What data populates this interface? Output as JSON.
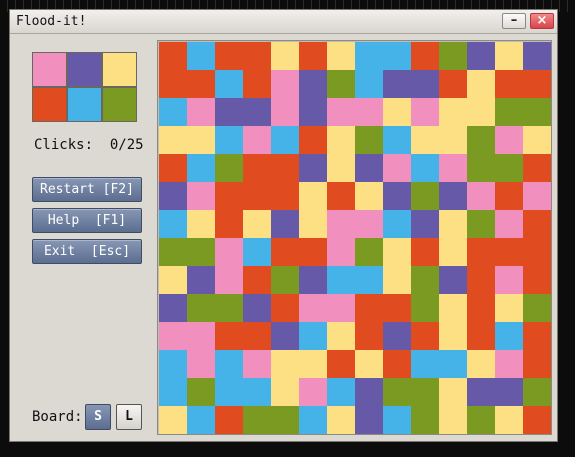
{
  "window": {
    "title": "Flood-it!",
    "minimize_label": "–",
    "close_label": "×"
  },
  "palette": {
    "P": "#f18fbf",
    "V": "#665aa8",
    "Y": "#fde084",
    "R": "#e04b20",
    "B": "#45b2e8",
    "G": "#7a9a21"
  },
  "color_buttons": [
    {
      "key": "P",
      "name": "color-button-pink"
    },
    {
      "key": "V",
      "name": "color-button-purple"
    },
    {
      "key": "Y",
      "name": "color-button-yellow"
    },
    {
      "key": "R",
      "name": "color-button-red"
    },
    {
      "key": "B",
      "name": "color-button-blue"
    },
    {
      "key": "G",
      "name": "color-button-green"
    }
  ],
  "clicks": {
    "label": "Clicks:",
    "value": "0/25"
  },
  "buttons": {
    "restart": "Restart [F2]",
    "help": "Help  [F1]",
    "exit": "Exit  [Esc]"
  },
  "board": {
    "label": "Board:",
    "small": "S",
    "large": "L"
  },
  "grid": [
    "RBRRYRYBBRGVYV",
    "RRBRPVGBVVRYRR",
    "BPVVPVPPYPYYGG",
    "YYBPBRYGBYYGPY",
    "RBGRRVYVPBPGGR",
    "VPRRRYRYVGVPRP",
    "BYRYVYPPBVYGPR",
    "GGPBRRPGYRYRRR",
    "YVPRGVBBYGVRPR",
    "VGGVRPPRRGYRYG",
    "PPRRVBYRVRYRBR",
    "BPBPYYRYRBBYPR",
    "BGBBYPBVGGYVVG",
    "YBRGGBYVBGYGYR"
  ]
}
